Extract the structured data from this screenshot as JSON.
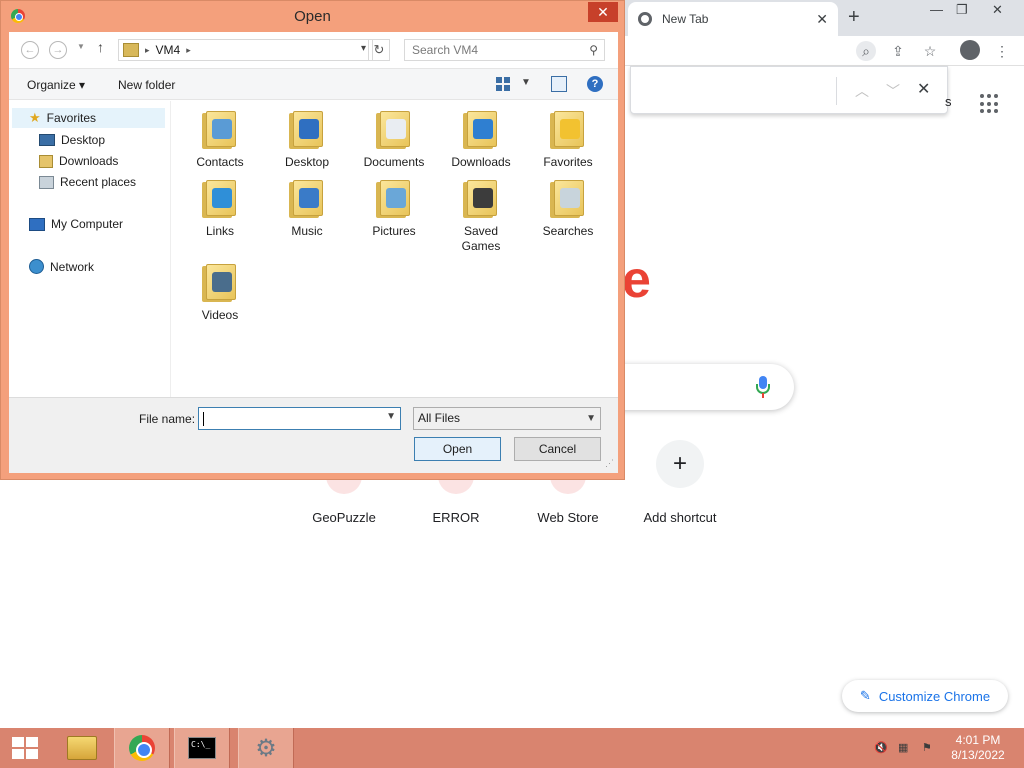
{
  "browser": {
    "tab_title": "New Tab",
    "partial_logo_letter": "e",
    "findbar_close": "✕",
    "apps_partial_text": "s",
    "shortcuts": [
      {
        "label": "GeoPuzzle"
      },
      {
        "label": "ERROR"
      },
      {
        "label": "Web Store"
      },
      {
        "label": "Add shortcut",
        "icon": "+"
      }
    ],
    "customize_label": "Customize Chrome"
  },
  "dialog": {
    "title": "Open",
    "address_path": "VM4",
    "search_placeholder": "Search VM4",
    "commands": {
      "organize": "Organize ▾",
      "new_folder": "New folder"
    },
    "nav": {
      "favorites": "Favorites",
      "desktop": "Desktop",
      "downloads": "Downloads",
      "recent": "Recent places",
      "my_computer": "My Computer",
      "network": "Network"
    },
    "files": [
      {
        "label": "Contacts",
        "glyph_color": "#5a9bd5"
      },
      {
        "label": "Desktop",
        "glyph_color": "#2f6fc1"
      },
      {
        "label": "Documents",
        "glyph_color": "#e9edf2"
      },
      {
        "label": "Downloads",
        "glyph_color": "#2f7fd1"
      },
      {
        "label": "Favorites",
        "glyph_color": "#f2c230"
      },
      {
        "label": "Links",
        "glyph_color": "#2f8fd8"
      },
      {
        "label": "Music",
        "glyph_color": "#3a7bc8"
      },
      {
        "label": "Pictures",
        "glyph_color": "#6aa7d8"
      },
      {
        "label": "Saved Games",
        "glyph_color": "#3c3c3c"
      },
      {
        "label": "Searches",
        "glyph_color": "#c8d4dc"
      },
      {
        "label": "Videos",
        "glyph_color": "#4a6d8c"
      }
    ],
    "file_name_label": "File name:",
    "file_name_value": "",
    "filter_value": "All Files",
    "open_label": "Open",
    "cancel_label": "Cancel"
  },
  "taskbar": {
    "time": "4:01 PM",
    "date": "8/13/2022"
  },
  "colors": {
    "dialog_frame": "#f4a07c",
    "taskbar": "#d9846f",
    "close_button": "#c7402a",
    "accent_blue": "#1a73e8"
  }
}
